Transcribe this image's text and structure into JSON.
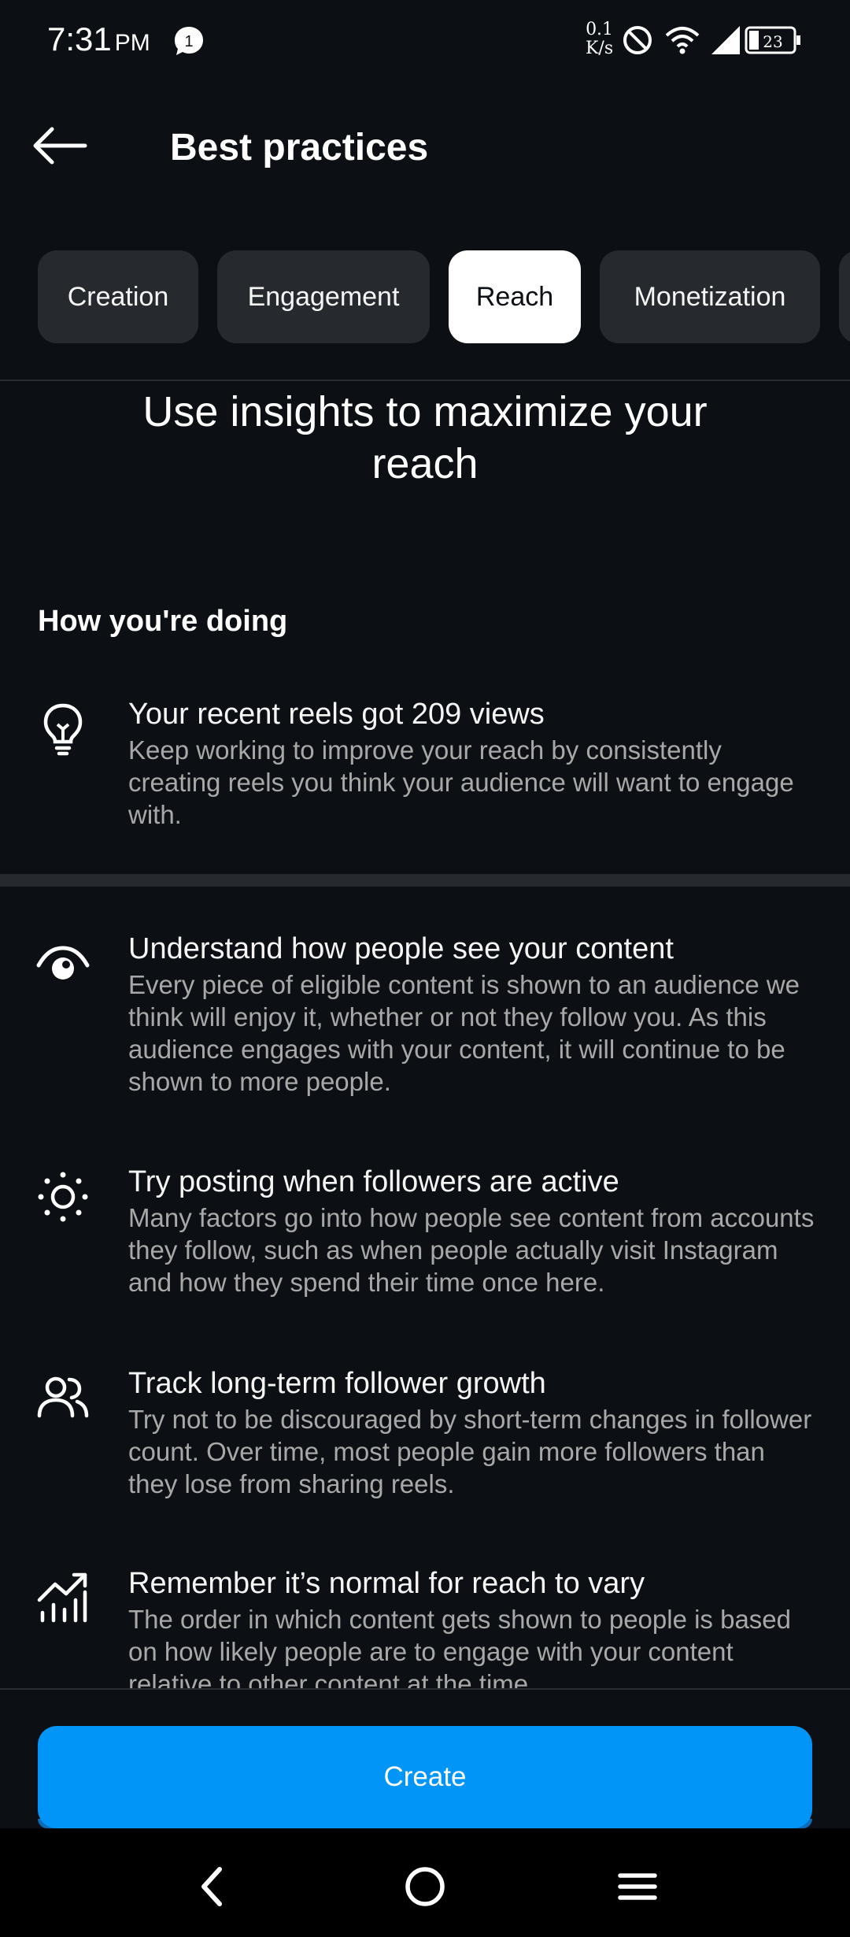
{
  "status_bar": {
    "time": "7:31",
    "ampm": "PM",
    "notification_count": "1",
    "net_speed_value": "0.1",
    "net_speed_unit": "K/s",
    "battery": "23"
  },
  "header": {
    "title": "Best practices"
  },
  "tabs": [
    {
      "label": "Creation",
      "active": false
    },
    {
      "label": "Engagement",
      "active": false
    },
    {
      "label": "Reach",
      "active": true
    },
    {
      "label": "Monetization",
      "active": false
    }
  ],
  "headline": "Use insights to maximize your reach",
  "how_doing": {
    "heading": "How you're doing",
    "title": "Your recent reels got 209 views",
    "description": "Keep working to improve your reach by consistently creating reels you think your audience will want to engage with."
  },
  "tips": [
    {
      "icon": "eye-icon",
      "title": "Understand how people see your content",
      "description": "Every piece of eligible content is shown to an audience we think will enjoy it, whether or not they follow you. As this audience engages with your content, it will continue to be shown to more people."
    },
    {
      "icon": "sun-icon",
      "title": "Try posting when followers are active",
      "description": "Many factors go into how people see content from accounts they follow, such as when people actually visit Instagram and how they spend their time once here."
    },
    {
      "icon": "people-icon",
      "title": "Track long-term follower growth",
      "description": "Try not to be discouraged by short-term changes in follower count. Over time, most people gain more followers than they lose from sharing reels."
    },
    {
      "icon": "trending-chart-icon",
      "title": "Remember it’s normal for reach to vary",
      "description": "The order in which content gets shown to people is based on how likely people are to engage with your content relative to other content at the time."
    }
  ],
  "create_button": "Create",
  "colors": {
    "background": "#0c1014",
    "accent": "#0095f6",
    "tab_active_bg": "#ffffff",
    "tab_bg": "#262a2f",
    "secondary_text": "#a8a8a8"
  }
}
